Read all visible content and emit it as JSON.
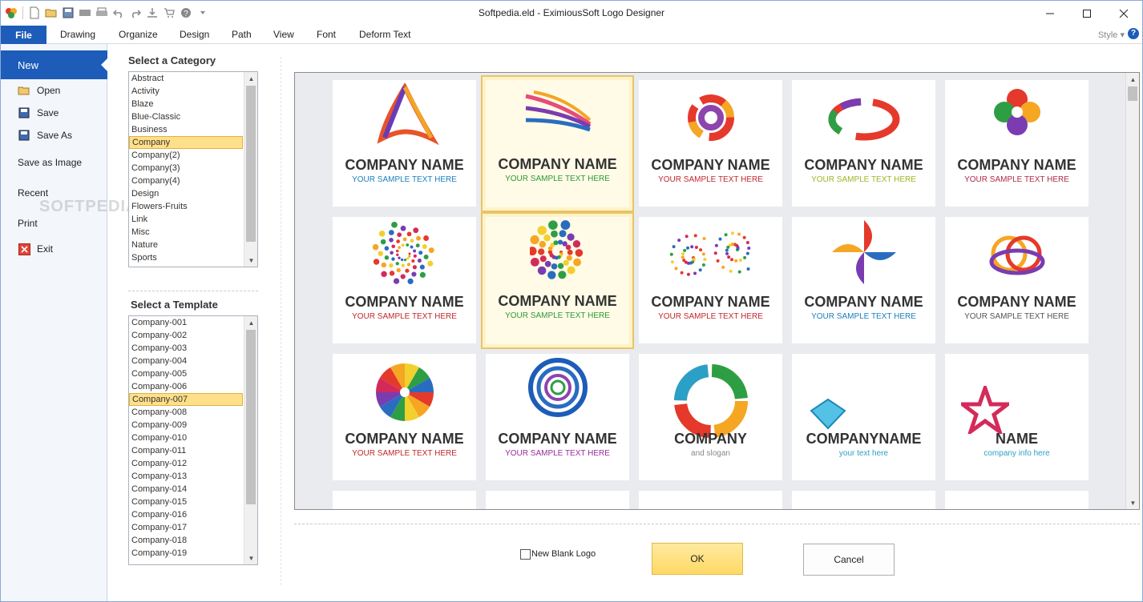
{
  "window": {
    "title": "Softpedia.eld - EximiousSoft Logo Designer"
  },
  "tabs": [
    "File",
    "Drawing",
    "Organize",
    "Design",
    "Path",
    "View",
    "Font",
    "Deform Text"
  ],
  "style_menu": "Style",
  "help_glyph": "?",
  "backstage": {
    "new": "New",
    "open": "Open",
    "save": "Save",
    "save_as": "Save As",
    "save_as_image": "Save as Image",
    "recent": "Recent",
    "print": "Print",
    "exit": "Exit",
    "watermark": "SOFTPEDIA"
  },
  "category": {
    "label": "Select a Category",
    "items": [
      "Abstract",
      "Activity",
      "Blaze",
      "Blue-Classic",
      "Business",
      "Company",
      "Company(2)",
      "Company(3)",
      "Company(4)",
      "Design",
      "Flowers-Fruits",
      "Link",
      "Misc",
      "Nature",
      "Sports"
    ],
    "selected_index": 5
  },
  "template": {
    "label": "Select a Template",
    "items": [
      "Company-001",
      "Company-002",
      "Company-003",
      "Company-004",
      "Company-005",
      "Company-006",
      "Company-007",
      "Company-008",
      "Company-009",
      "Company-010",
      "Company-011",
      "Company-012",
      "Company-013",
      "Company-014",
      "Company-015",
      "Company-016",
      "Company-017",
      "Company-018",
      "Company-019"
    ],
    "selected_index": 6
  },
  "gallery": {
    "row1": [
      {
        "name": "COMPANY NAME",
        "sub": "YOUR SAMPLE TEXT HERE",
        "sub_color": "#1a7fbf",
        "art": "triangle"
      },
      {
        "name": "COMPANY NAME",
        "sub": "YOUR SAMPLE TEXT HERE",
        "sub_color": "#2a9a3a",
        "art": "wings"
      },
      {
        "name": "COMPANY NAME",
        "sub": "YOUR SAMPLE TEXT HERE",
        "sub_color": "#c0282c",
        "art": "swirl"
      },
      {
        "name": "COMPANY NAME",
        "sub": "YOUR SAMPLE TEXT HERE",
        "sub_color": "#9ab825",
        "art": "ring"
      },
      {
        "name": "COMPANY NAME",
        "sub": "YOUR SAMPLE TEXT HERE",
        "sub_color": "#b0294a",
        "art": "flower"
      }
    ],
    "row2": [
      {
        "name": "COMPANY NAME",
        "sub": "YOUR SAMPLE TEXT HERE",
        "sub_color": "#c0282c",
        "art": "dots"
      },
      {
        "name": "COMPANY NAME",
        "sub": "YOUR SAMPLE TEXT HERE",
        "sub_color": "#2a9a3a",
        "art": "spiral"
      },
      {
        "name": "COMPANY NAME",
        "sub": "YOUR SAMPLE TEXT HERE",
        "sub_color": "#c0282c",
        "art": "dotswirl"
      },
      {
        "name": "COMPANY NAME",
        "sub": "YOUR SAMPLE TEXT HERE",
        "sub_color": "#1a7fbf",
        "art": "pinwheel"
      },
      {
        "name": "COMPANY NAME",
        "sub": "YOUR SAMPLE TEXT HERE",
        "sub_color": "#555555",
        "art": "rings"
      }
    ],
    "row3": [
      {
        "name": "COMPANY NAME",
        "sub": "YOUR SAMPLE TEXT HERE",
        "sub_color": "#c0282c",
        "art": "wheel"
      },
      {
        "name": "COMPANY NAME",
        "sub": "YOUR SAMPLE TEXT HERE",
        "sub_color": "#9a2aa0",
        "art": "circles"
      },
      {
        "name": "COMPANY",
        "sub": "and slogan",
        "sub_color": "#888888",
        "art": "arrows"
      },
      {
        "name": "COMPANYNAME",
        "sub": "your text here",
        "sub_color": "#2ba0c7",
        "art": "diamond"
      },
      {
        "name": "NAME",
        "sub": "company info here",
        "sub_color": "#2ba0c7",
        "art": "star"
      }
    ]
  },
  "bottom": {
    "new_blank_logo": "New Blank Logo",
    "ok": "OK",
    "cancel": "Cancel"
  },
  "colors": {
    "accent": "#1d5cb9",
    "selection": "#ffe08a",
    "ok_button": "#ffd964"
  }
}
